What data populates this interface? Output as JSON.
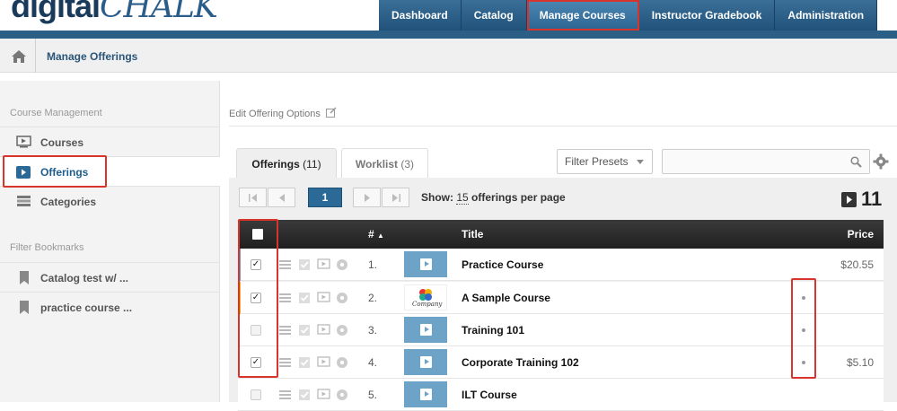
{
  "header": {
    "logo_main": "digital",
    "logo_script": "CHALK",
    "tabs": [
      "Dashboard",
      "Catalog",
      "Manage Courses",
      "Instructor Gradebook",
      "Administration"
    ]
  },
  "breadcrumb": {
    "current": "Manage Offerings"
  },
  "sidebar": {
    "section1": "Course Management",
    "items": [
      {
        "label": "Courses",
        "icon": "courses-icon"
      },
      {
        "label": "Offerings",
        "icon": "offerings-icon"
      },
      {
        "label": "Categories",
        "icon": "categories-icon"
      }
    ],
    "section2": "Filter Bookmarks",
    "bookmarks": [
      "Catalog test w/ ...",
      "practice course ..."
    ]
  },
  "main": {
    "edit_options": "Edit Offering Options",
    "tabs": [
      {
        "label": "Offerings",
        "count": "(11)"
      },
      {
        "label": "Worklist",
        "count": "(3)"
      }
    ],
    "filter_presets": "Filter Presets",
    "search_placeholder": "",
    "pagination": {
      "page": "1",
      "show_prefix": "Show:",
      "per_page": "15",
      "show_suffix": "offerings per page"
    },
    "total": "11",
    "columns": {
      "num": "#",
      "title": "Title",
      "price": "Price"
    },
    "rows": [
      {
        "num": "1.",
        "title": "Practice Course",
        "price": "$20.55",
        "checked": "✓",
        "bar": "#5aa0d0",
        "thumb": "play",
        "dot": false
      },
      {
        "num": "2.",
        "title": "A Sample Course",
        "price": "",
        "checked": "✓",
        "bar": "#f0b400",
        "thumb": "company",
        "dot": true
      },
      {
        "num": "3.",
        "title": "Training 101",
        "price": "",
        "checked": "",
        "bar": "",
        "thumb": "play",
        "dot": true
      },
      {
        "num": "4.",
        "title": "Corporate Training 102",
        "price": "$5.10",
        "checked": "✓",
        "bar": "",
        "thumb": "play",
        "dot": true
      },
      {
        "num": "5.",
        "title": "ILT Course",
        "price": "",
        "checked": "",
        "bar": "",
        "thumb": "play",
        "dot": false
      }
    ],
    "company_logo_text": "Company"
  },
  "colors": {
    "brand": "#2b5f86",
    "highlight": "#d9342b",
    "accent": "#1e5d8c"
  }
}
